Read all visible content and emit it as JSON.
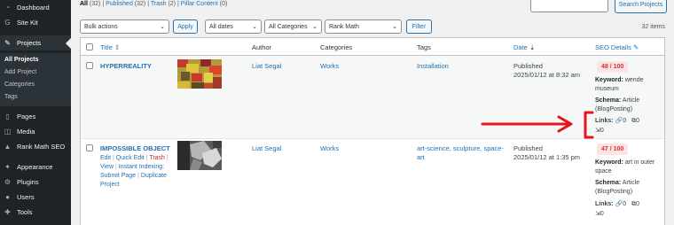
{
  "sidebar": {
    "items": [
      {
        "label": "Dashboard",
        "icon": "dashboard-icon",
        "glyph": "◔"
      },
      {
        "label": "Site Kit",
        "icon": "site-kit-icon",
        "glyph": "G"
      },
      {
        "label": "Projects",
        "icon": "projects-icon",
        "glyph": "✎"
      },
      {
        "label": "Pages",
        "icon": "pages-icon",
        "glyph": "▯"
      },
      {
        "label": "Media",
        "icon": "media-icon",
        "glyph": "◫"
      },
      {
        "label": "Rank Math SEO",
        "icon": "rank-math-icon",
        "glyph": "▲"
      },
      {
        "label": "Appearance",
        "icon": "appearance-icon",
        "glyph": "✦"
      },
      {
        "label": "Plugins",
        "icon": "plugins-icon",
        "glyph": "⚙"
      },
      {
        "label": "Users",
        "icon": "users-icon",
        "glyph": "●"
      },
      {
        "label": "Tools",
        "icon": "tools-icon",
        "glyph": "✚"
      }
    ],
    "submenu": [
      "All Projects",
      "Add Project",
      "Categories",
      "Tags"
    ]
  },
  "filters": {
    "all": "All",
    "all_count": "(32)",
    "published": "Published",
    "published_count": "(32)",
    "trash": "Trash",
    "trash_count": "(2)",
    "pillar": "Pillar Content",
    "pillar_count": "(0)",
    "sep": "|"
  },
  "search": {
    "placeholder": "",
    "button": "Search Projects"
  },
  "toolbar": {
    "bulk_actions": "Bulk actions",
    "apply": "Apply",
    "dates": "All dates",
    "categories": "All Categories",
    "rank_math": "Rank Math",
    "filter": "Filter",
    "item_count": "32 items"
  },
  "columns": {
    "title": "Title",
    "author": "Author",
    "categories": "Categories",
    "tags": "Tags",
    "date": "Date",
    "seo": "SEO Details"
  },
  "rows": [
    {
      "title": "HYPERREALITY",
      "author": "Liat Segal",
      "category": "Works",
      "tags": "Installation",
      "status": "Published",
      "date": "2025/01/12 at 8:32 am",
      "score": "48 / 100",
      "keyword_label": "Keyword:",
      "keyword": "wende museum",
      "schema_label": "Schema:",
      "schema": "Article (BlogPosting)",
      "links_label": "Links:",
      "internal": "0",
      "external": "0",
      "incoming": "0"
    },
    {
      "title": "IMPOSSIBLE OBJECT",
      "author": "Liat Segal",
      "category": "Works",
      "tags": "art-science, sculpture, space-art",
      "status": "Published",
      "date": "2025/01/12 at 1:35 pm",
      "score": "47 / 100",
      "keyword_label": "Keyword:",
      "keyword": "art in outer space",
      "schema_label": "Schema:",
      "schema": "Article (BlogPosting)",
      "links_label": "Links:",
      "internal": "0",
      "external": "0",
      "incoming": "0",
      "actions": {
        "edit": "Edit",
        "quick_edit": "Quick Edit",
        "trash": "Trash",
        "view": "View",
        "instant_indexing": "Instant Indexing:",
        "submit_page": "Submit Page",
        "duplicate": "Duplicate Project",
        "sep": "|"
      }
    }
  ],
  "colors": {
    "sidebar_bg": "#1d2327",
    "link": "#2271b1",
    "score_bg": "#fce4e4",
    "score_text": "#dc3232",
    "annotation": "#e8141c"
  }
}
